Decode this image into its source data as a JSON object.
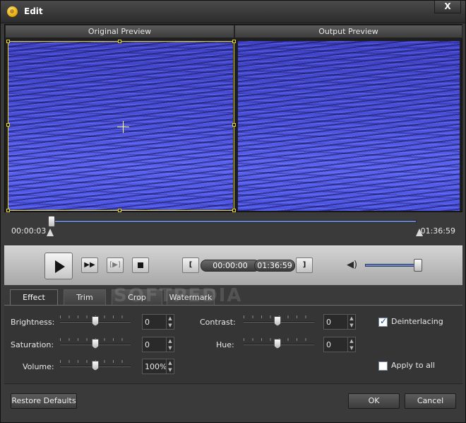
{
  "window": {
    "title": "Edit",
    "close_label": "X"
  },
  "preview": {
    "original_label": "Original Preview",
    "output_label": "Output Preview"
  },
  "timeline": {
    "start_time": "00:00:03",
    "end_time": "01:36:59",
    "progress_fraction": 0.001
  },
  "playback": {
    "mark_in_label": "[",
    "mark_out_label": "]",
    "mark_in_time": "00:00:00",
    "mark_out_time": "01:36:59",
    "fast_forward_label": "▶▶",
    "next_frame_label": "[▶]",
    "volume_icon": "speaker-icon",
    "volume_level": 0.9
  },
  "tabs": [
    {
      "label": "Effect",
      "active": true
    },
    {
      "label": "Trim",
      "active": false
    },
    {
      "label": "Crop",
      "active": false
    },
    {
      "label": "Watermark",
      "active": false
    }
  ],
  "watermark_logo": "SOFTPEDIA",
  "effect": {
    "brightness_label": "Brightness:",
    "brightness_value": "0",
    "contrast_label": "Contrast:",
    "contrast_value": "0",
    "saturation_label": "Saturation:",
    "saturation_value": "0",
    "hue_label": "Hue:",
    "hue_value": "0",
    "volume_label": "Volume:",
    "volume_value": "100%",
    "deinterlacing_label": "Deinterlacing",
    "deinterlacing_checked": true,
    "apply_all_label": "Apply to all",
    "apply_all_checked": false
  },
  "buttons": {
    "restore_defaults": "Restore Defaults",
    "ok": "OK",
    "cancel": "Cancel"
  },
  "colors": {
    "crop_frame": "#e6d71e",
    "timeline_track": "#6d83b8",
    "checkbox_check": "#1f4fa0"
  }
}
